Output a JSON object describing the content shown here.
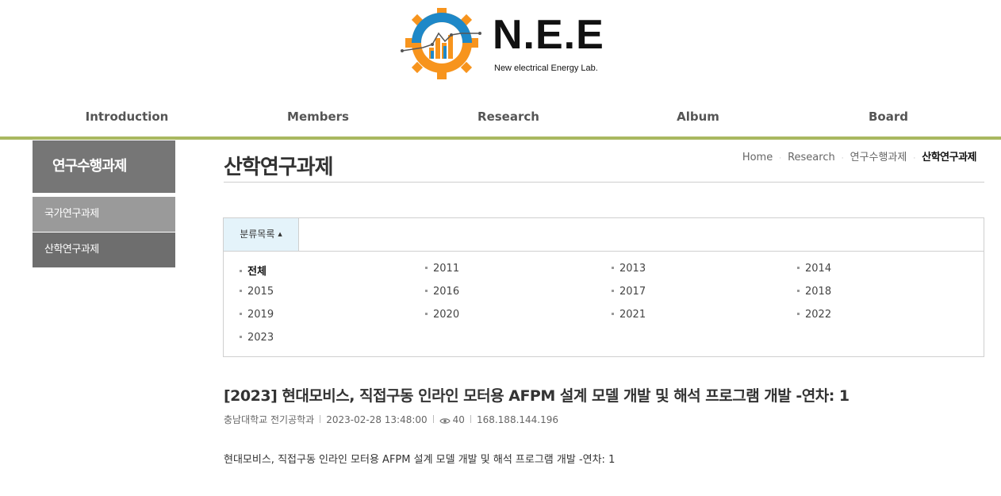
{
  "brand": {
    "name": "N.E.E",
    "tagline": "New electrical Energy Lab."
  },
  "nav": {
    "items": [
      "Introduction",
      "Members",
      "Research",
      "Album",
      "Board"
    ]
  },
  "sidebar": {
    "title": "연구수행과제",
    "items": [
      "국가연구과제",
      "산학연구과제"
    ]
  },
  "page": {
    "title": "산학연구과제",
    "breadcrumb": [
      "Home",
      "Research",
      "연구수행과제",
      "산학연구과제"
    ]
  },
  "category": {
    "toggle_label": "분류목록",
    "items": [
      "전체",
      "2011",
      "2013",
      "2014",
      "2015",
      "2016",
      "2017",
      "2018",
      "2019",
      "2020",
      "2021",
      "2022",
      "2023"
    ],
    "selected": "전체"
  },
  "post": {
    "title": "[2023] 현대모비스, 직접구동 인라인 모터용 AFPM 설계 모델 개발 및 해석 프로그램 개발 -연차: 1",
    "author": "충남대학교 전기공학과",
    "date": "2023-02-28 13:48:00",
    "views": "40",
    "ip": "168.188.144.196",
    "body": "현대모비스, 직접구동 인라인 모터용 AFPM 설계 모델 개발 및 해석 프로그램 개발 -연차: 1"
  },
  "colors": {
    "nav_underline": "#a9b860",
    "sidebar_title_bg": "#767676",
    "category_tab_bg": "#e4f3fa",
    "logo_blue": "#1e88c8",
    "logo_orange": "#f7941d"
  },
  "icons": {
    "caret": "caret-up-icon",
    "views": "eye-icon"
  }
}
